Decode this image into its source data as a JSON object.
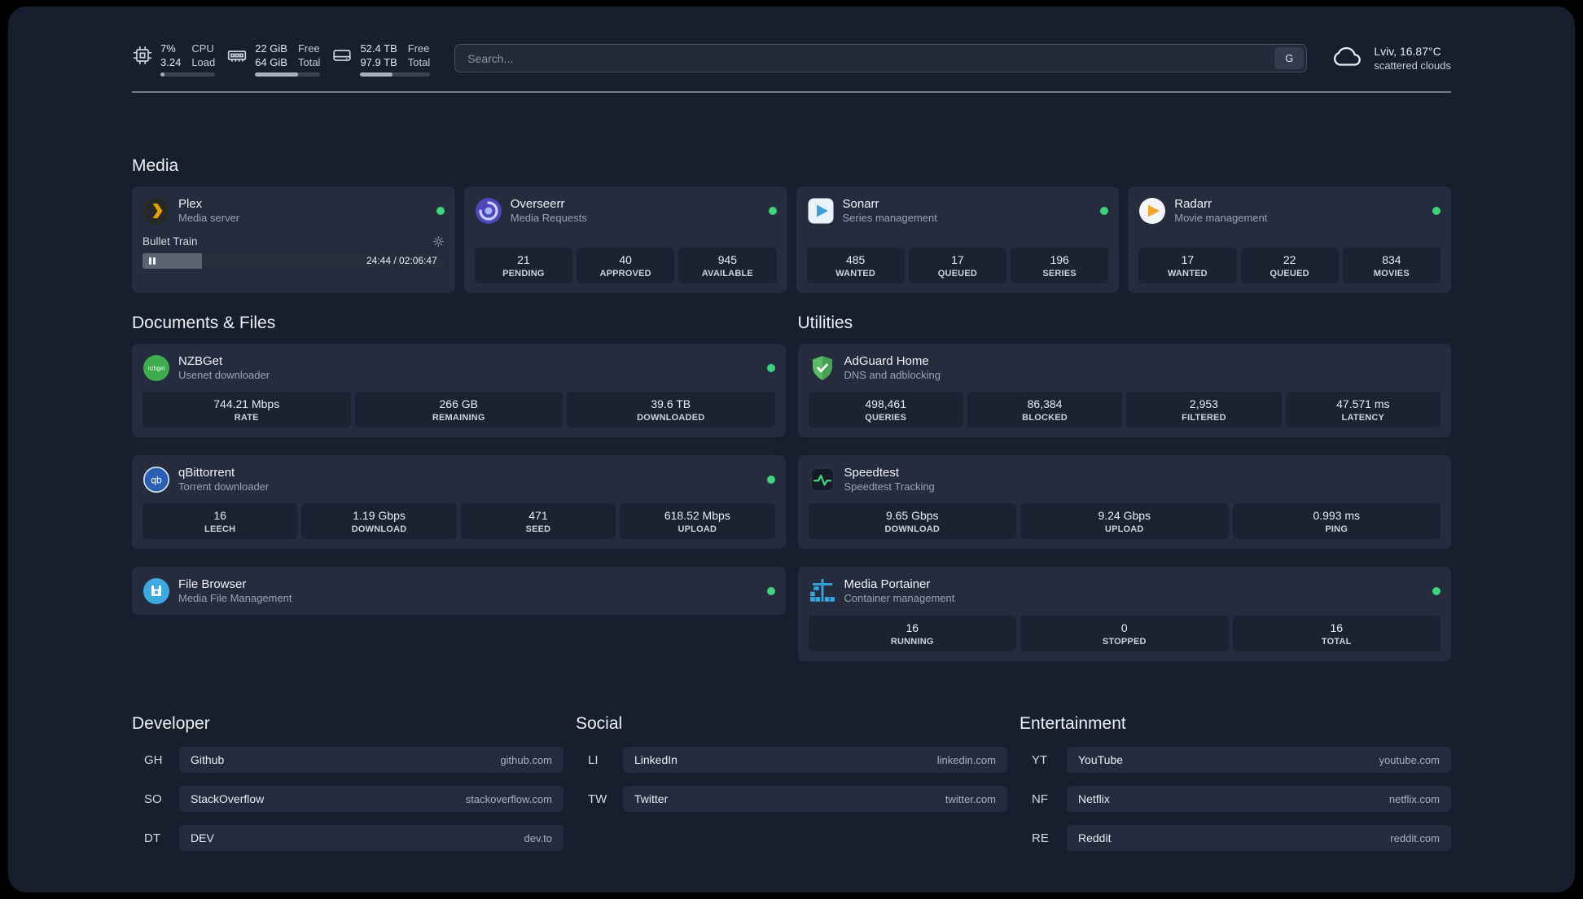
{
  "colors": {
    "background": "#171e2e",
    "card": "#242c3d",
    "stat_box": "#1b2231",
    "status_online": "#3ed37c",
    "plex_accent": "#e5a00d",
    "adguard_green": "#5bba67",
    "portainer_blue": "#37a5dc",
    "speedtest_green": "#41d683"
  },
  "topbar": {
    "cpu": {
      "value": "7%",
      "load": "3.24",
      "label_top": "CPU",
      "label_bottom": "Load",
      "used_percent": 7
    },
    "memory": {
      "free": "22 GiB",
      "total": "64 GiB",
      "label_top": "Free",
      "label_bottom": "Total",
      "used_percent": 66
    },
    "disk": {
      "free": "52.4 TB",
      "total": "97.9 TB",
      "label_top": "Free",
      "label_bottom": "Total",
      "used_percent": 46
    },
    "search": {
      "placeholder": "Search...",
      "provider_label": "G"
    },
    "weather": {
      "location": "Lviv, 16.87°C",
      "condition": "scattered clouds"
    }
  },
  "media": {
    "section_title": "Media",
    "plex": {
      "title": "Plex",
      "subtitle": "Media server",
      "status": "online",
      "now_playing": "Bullet Train",
      "time": "24:44 / 02:06:47",
      "progress_percent": 19.6
    },
    "overseerr": {
      "title": "Overseerr",
      "subtitle": "Media Requests",
      "status": "online",
      "stats": [
        {
          "value": "21",
          "label": "PENDING"
        },
        {
          "value": "40",
          "label": "APPROVED"
        },
        {
          "value": "945",
          "label": "AVAILABLE"
        }
      ]
    },
    "sonarr": {
      "title": "Sonarr",
      "subtitle": "Series management",
      "status": "online",
      "stats": [
        {
          "value": "485",
          "label": "WANTED"
        },
        {
          "value": "17",
          "label": "QUEUED"
        },
        {
          "value": "196",
          "label": "SERIES"
        }
      ]
    },
    "radarr": {
      "title": "Radarr",
      "subtitle": "Movie management",
      "status": "online",
      "stats": [
        {
          "value": "17",
          "label": "WANTED"
        },
        {
          "value": "22",
          "label": "QUEUED"
        },
        {
          "value": "834",
          "label": "MOVIES"
        }
      ]
    }
  },
  "documents": {
    "section_title": "Documents & Files",
    "nzbget": {
      "title": "NZBGet",
      "subtitle": "Usenet downloader",
      "status": "online",
      "stats": [
        {
          "value": "744.21 Mbps",
          "label": "RATE"
        },
        {
          "value": "266 GB",
          "label": "REMAINING"
        },
        {
          "value": "39.6 TB",
          "label": "DOWNLOADED"
        }
      ]
    },
    "qbittorrent": {
      "title": "qBittorrent",
      "subtitle": "Torrent downloader",
      "status": "online",
      "stats": [
        {
          "value": "16",
          "label": "LEECH"
        },
        {
          "value": "1.19 Gbps",
          "label": "DOWNLOAD"
        },
        {
          "value": "471",
          "label": "SEED"
        },
        {
          "value": "618.52 Mbps",
          "label": "UPLOAD"
        }
      ]
    },
    "filebrowser": {
      "title": "File Browser",
      "subtitle": "Media File Management",
      "status": "online"
    }
  },
  "utilities": {
    "section_title": "Utilities",
    "adguard": {
      "title": "AdGuard Home",
      "subtitle": "DNS and adblocking",
      "stats": [
        {
          "value": "498,461",
          "label": "QUERIES"
        },
        {
          "value": "86,384",
          "label": "BLOCKED"
        },
        {
          "value": "2,953",
          "label": "FILTERED"
        },
        {
          "value": "47.571 ms",
          "label": "LATENCY"
        }
      ]
    },
    "speedtest": {
      "title": "Speedtest",
      "subtitle": "Speedtest Tracking",
      "stats": [
        {
          "value": "9.65 Gbps",
          "label": "DOWNLOAD"
        },
        {
          "value": "9.24 Gbps",
          "label": "UPLOAD"
        },
        {
          "value": "0.993 ms",
          "label": "PING"
        }
      ]
    },
    "portainer": {
      "title": "Media Portainer",
      "subtitle": "Container management",
      "status": "online",
      "stats": [
        {
          "value": "16",
          "label": "RUNNING"
        },
        {
          "value": "0",
          "label": "STOPPED"
        },
        {
          "value": "16",
          "label": "TOTAL"
        }
      ]
    }
  },
  "bookmarks": {
    "developer": {
      "section_title": "Developer",
      "items": [
        {
          "abbr": "GH",
          "name": "Github",
          "domain": "github.com"
        },
        {
          "abbr": "SO",
          "name": "StackOverflow",
          "domain": "stackoverflow.com"
        },
        {
          "abbr": "DT",
          "name": "DEV",
          "domain": "dev.to"
        }
      ]
    },
    "social": {
      "section_title": "Social",
      "items": [
        {
          "abbr": "LI",
          "name": "LinkedIn",
          "domain": "linkedin.com"
        },
        {
          "abbr": "TW",
          "name": "Twitter",
          "domain": "twitter.com"
        }
      ]
    },
    "entertainment": {
      "section_title": "Entertainment",
      "items": [
        {
          "abbr": "YT",
          "name": "YouTube",
          "domain": "youtube.com"
        },
        {
          "abbr": "NF",
          "name": "Netflix",
          "domain": "netflix.com"
        },
        {
          "abbr": "RE",
          "name": "Reddit",
          "domain": "reddit.com"
        }
      ]
    }
  }
}
